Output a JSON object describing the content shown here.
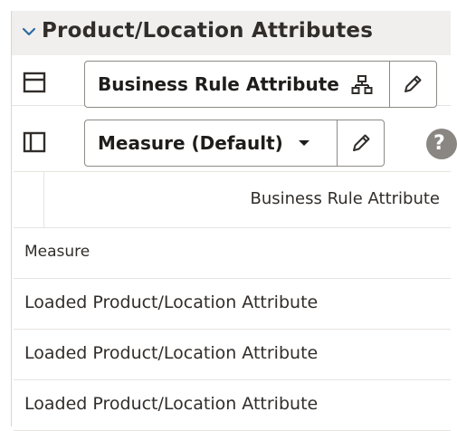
{
  "panel": {
    "title": "Product/Location Attributes"
  },
  "row_layout": {
    "select_label": "Business Rule Attribute"
  },
  "column_layout": {
    "select_label": "Measure (Default)",
    "help_label": "?"
  },
  "grid": {
    "column_header": "Business Rule Attribute",
    "rows": [
      "Measure",
      "Loaded Product/Location Attribute",
      "Loaded Product/Location Attribute",
      "Loaded Product/Location Attribute"
    ]
  },
  "icons": {
    "collapse": "chevron-down-icon",
    "row_layout": "row-layout-icon",
    "column_layout": "column-layout-icon",
    "hierarchy": "hierarchy-icon",
    "edit": "pencil-icon",
    "dropdown": "caret-down-icon",
    "help": "help-icon"
  },
  "colors": {
    "header_bg": "#f1efed",
    "border": "#8e8a85",
    "help_badge": "#8a8682"
  }
}
